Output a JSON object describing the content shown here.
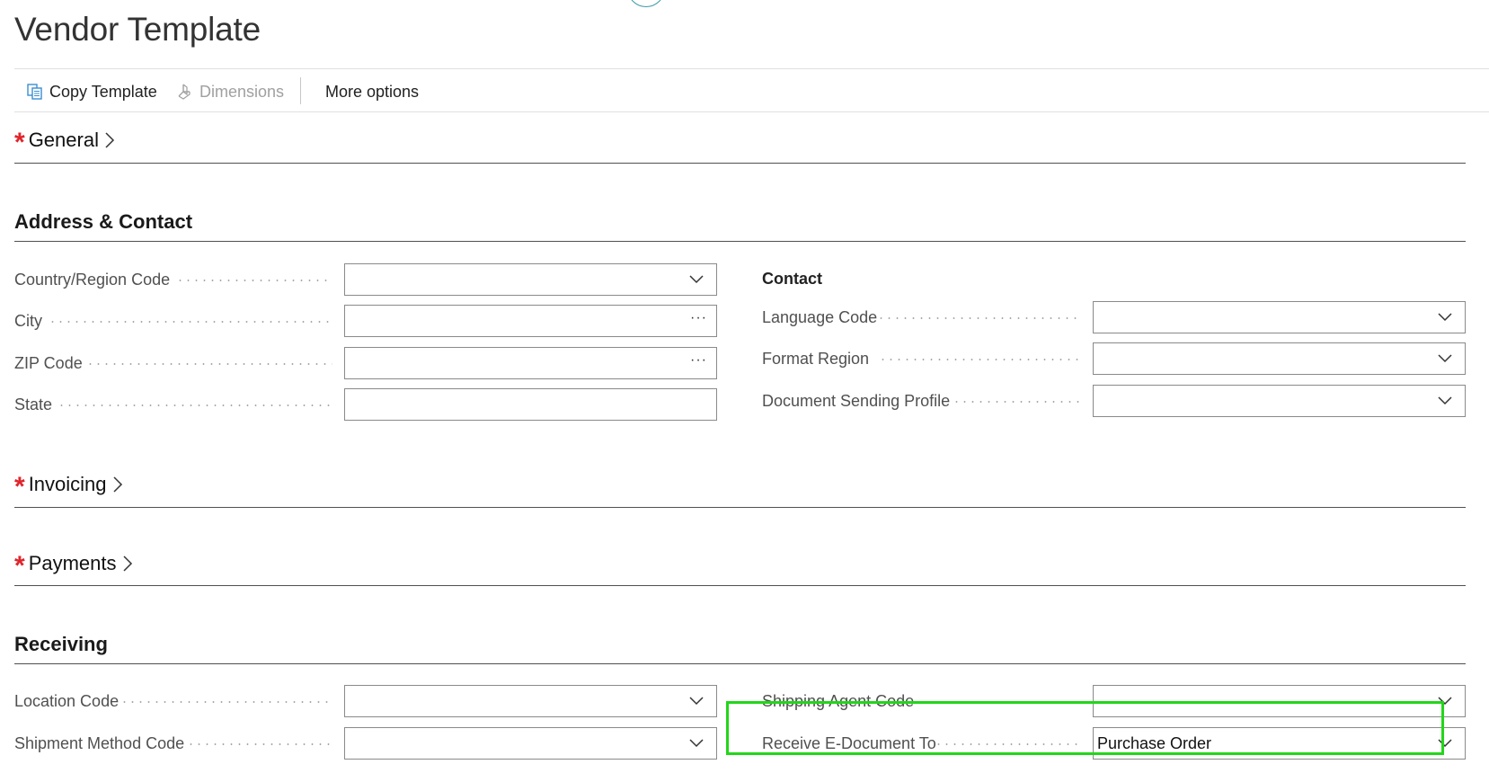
{
  "page": {
    "title": "Vendor Template"
  },
  "actions": {
    "copy_template": "Copy Template",
    "dimensions": "Dimensions",
    "more_options": "More options"
  },
  "sections": {
    "general": "General",
    "address_contact": "Address & Contact",
    "invoicing": "Invoicing",
    "payments": "Payments",
    "receiving": "Receiving"
  },
  "address": {
    "country_region_code": {
      "label": "Country/Region Code",
      "value": ""
    },
    "city": {
      "label": "City",
      "value": ""
    },
    "zip_code": {
      "label": "ZIP Code",
      "value": ""
    },
    "state": {
      "label": "State",
      "value": ""
    }
  },
  "contact": {
    "heading": "Contact",
    "language_code": {
      "label": "Language Code",
      "value": ""
    },
    "format_region": {
      "label": "Format Region",
      "value": ""
    },
    "document_sending_profile": {
      "label": "Document Sending Profile",
      "value": ""
    }
  },
  "receiving": {
    "location_code": {
      "label": "Location Code",
      "value": ""
    },
    "shipment_method_code": {
      "label": "Shipment Method Code",
      "value": ""
    },
    "shipping_agent_code": {
      "label": "Shipping Agent Code",
      "value": ""
    },
    "receive_e_document_to": {
      "label": "Receive E-Document To",
      "value": "Purchase Order"
    }
  },
  "colors": {
    "required_star": "#e0242a",
    "highlight": "#22d61a",
    "icon_accent": "#3a8fd1"
  },
  "icons": {
    "copy_template": "copy-icon",
    "dimensions": "dimensions-icon",
    "dropdown": "chevron-down-icon",
    "lookup": "ellipsis-icon",
    "expand": "chevron-right-icon",
    "required": "required-asterisk-icon"
  }
}
